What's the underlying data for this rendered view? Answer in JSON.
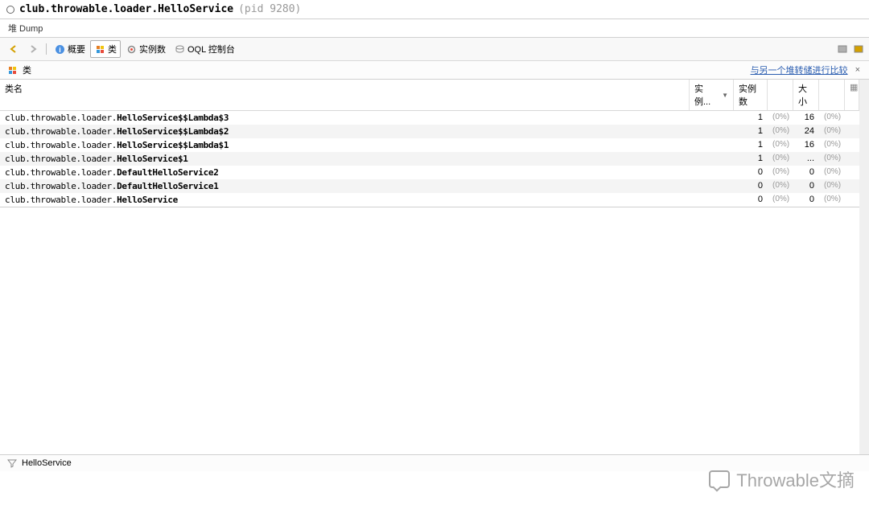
{
  "title": {
    "main": "club.throwable.loader.HelloService",
    "pid": "(pid 9280)"
  },
  "subtitle": "堆 Dump",
  "toolbar": {
    "overview": "概要",
    "classes": "类",
    "instances": "实例数",
    "oql": "OQL 控制台"
  },
  "panel": {
    "label": "类",
    "compare_link": "与另一个堆转储进行比较",
    "close": "×"
  },
  "columns": {
    "name": "类名",
    "inst": "实例...",
    "count": "实例数",
    "size": "大小"
  },
  "rows": [
    {
      "pkg": "club.throwable.loader.",
      "cls": "HelloService$$Lambda$3",
      "count": "1",
      "pct1": "(0%)",
      "size": "16",
      "pct2": "(0%)"
    },
    {
      "pkg": "club.throwable.loader.",
      "cls": "HelloService$$Lambda$2",
      "count": "1",
      "pct1": "(0%)",
      "size": "24",
      "pct2": "(0%)"
    },
    {
      "pkg": "club.throwable.loader.",
      "cls": "HelloService$$Lambda$1",
      "count": "1",
      "pct1": "(0%)",
      "size": "16",
      "pct2": "(0%)"
    },
    {
      "pkg": "club.throwable.loader.",
      "cls": "HelloService$1",
      "count": "1",
      "pct1": "(0%)",
      "size": "...",
      "pct2": "(0%)"
    },
    {
      "pkg": "club.throwable.loader.",
      "cls": "DefaultHelloService2",
      "count": "0",
      "pct1": "(0%)",
      "size": "0",
      "pct2": "(0%)"
    },
    {
      "pkg": "club.throwable.loader.",
      "cls": "DefaultHelloService1",
      "count": "0",
      "pct1": "(0%)",
      "size": "0",
      "pct2": "(0%)"
    },
    {
      "pkg": "club.throwable.loader.",
      "cls": "HelloService",
      "count": "0",
      "pct1": "(0%)",
      "size": "0",
      "pct2": "(0%)"
    }
  ],
  "status": "HelloService",
  "watermark": "Throwable文摘"
}
